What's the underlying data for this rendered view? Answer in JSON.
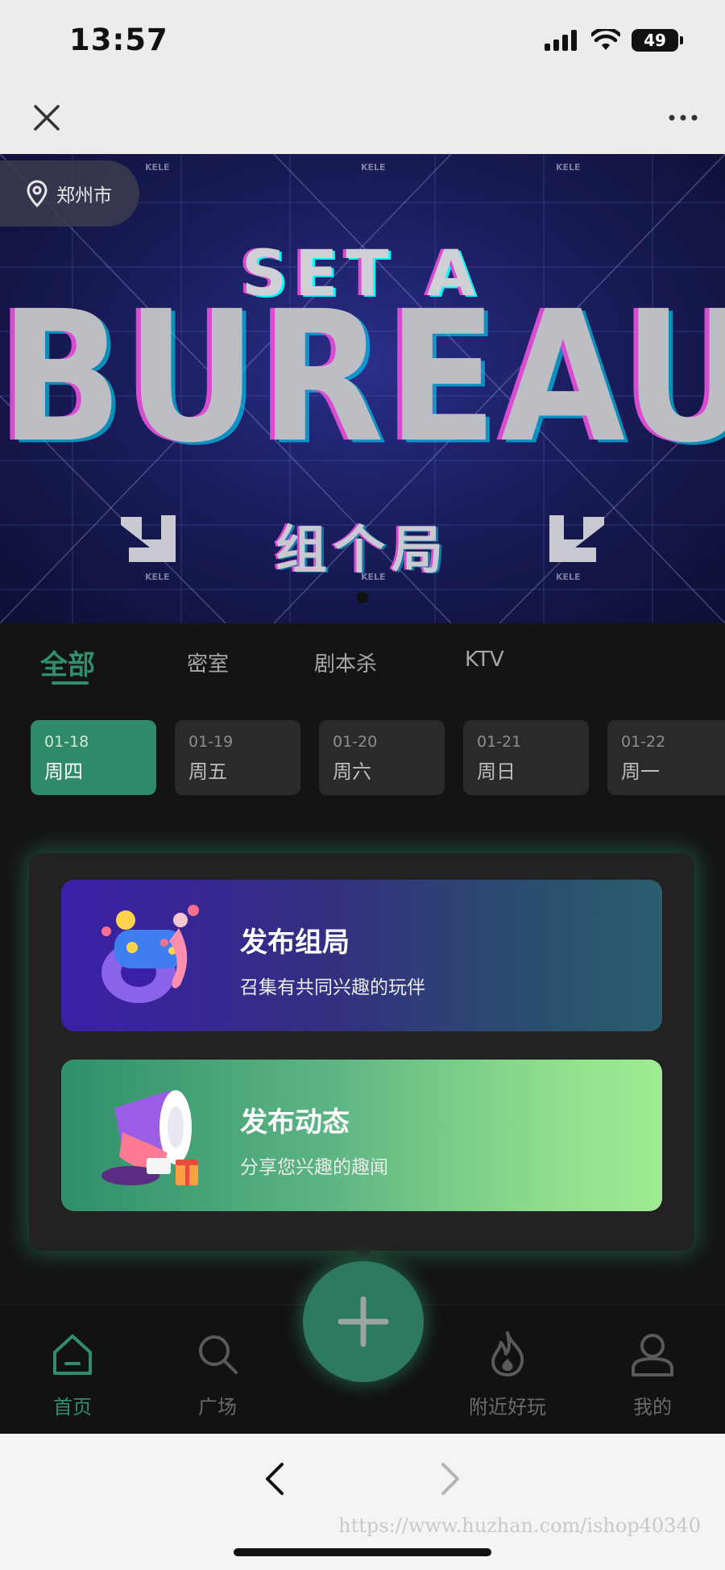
{
  "status_bar": {
    "time": "13:57",
    "battery": "49"
  },
  "location": {
    "city": "郑州市"
  },
  "banner": {
    "line1": "SET A",
    "line2": "BUREAU",
    "line3": "组个局",
    "watermark_text": "KELE"
  },
  "category_tabs": [
    {
      "label": "全部",
      "active": true
    },
    {
      "label": "密室",
      "active": false
    },
    {
      "label": "剧本杀",
      "active": false
    },
    {
      "label": "KTV",
      "active": false
    }
  ],
  "dates": [
    {
      "date": "01-18",
      "weekday": "周四",
      "active": true
    },
    {
      "date": "01-19",
      "weekday": "周五",
      "active": false
    },
    {
      "date": "01-20",
      "weekday": "周六",
      "active": false
    },
    {
      "date": "01-21",
      "weekday": "周日",
      "active": false
    },
    {
      "date": "01-22",
      "weekday": "周一",
      "active": false
    }
  ],
  "publish_panel": {
    "group": {
      "title": "发布组局",
      "subtitle": "召集有共同兴趣的玩伴"
    },
    "post": {
      "title": "发布动态",
      "subtitle": "分享您兴趣的趣闻"
    }
  },
  "tabbar": [
    {
      "label": "首页",
      "icon": "home-icon",
      "active": true
    },
    {
      "label": "广场",
      "icon": "search-icon",
      "active": false
    },
    {
      "label": "附近好玩",
      "icon": "flame-icon",
      "active": false
    },
    {
      "label": "我的",
      "icon": "user-icon",
      "active": false
    }
  ],
  "browser": {
    "watermark": "https://www.huzhan.com/ishop40340"
  },
  "colors": {
    "accent": "#2f8f6a",
    "background": "#141414",
    "banner": "#1a1d5c"
  }
}
